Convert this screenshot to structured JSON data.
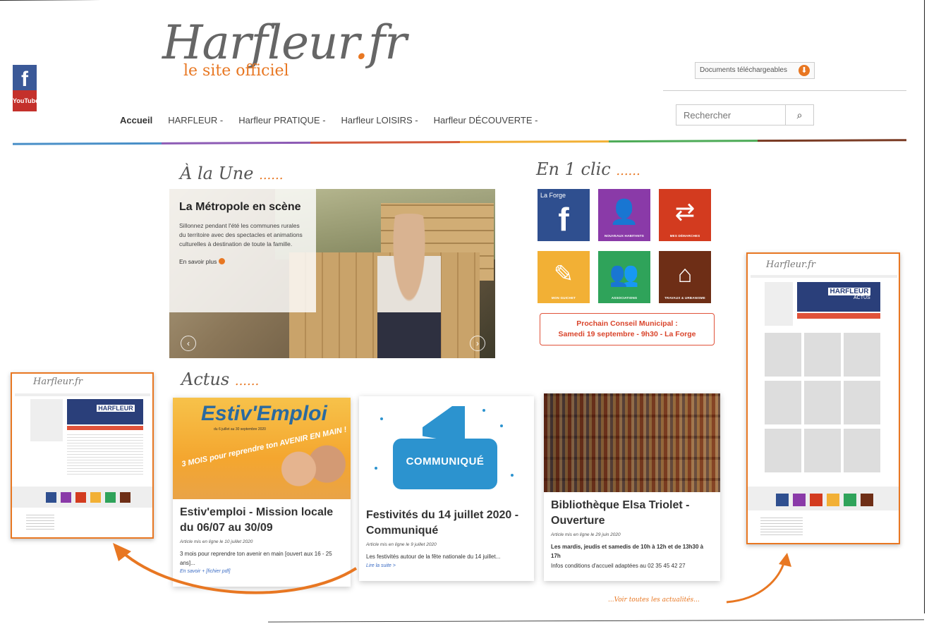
{
  "site": {
    "logo_main": "Harfleur",
    "logo_dot": ".",
    "logo_tld": "fr",
    "logo_sub": "le site officiel"
  },
  "social": {
    "facebook": "f",
    "youtube": "YouTube"
  },
  "header": {
    "docs_label": "Documents téléchargeables",
    "search_placeholder": "Rechercher"
  },
  "nav": {
    "items": [
      {
        "label": "Accueil"
      },
      {
        "label": "HARFLEUR -"
      },
      {
        "label": "Harfleur PRATIQUE -"
      },
      {
        "label": "Harfleur LOISIRS -"
      },
      {
        "label": "Harfleur DÉCOUVERTE -"
      }
    ]
  },
  "colors": {
    "accent": "#e87722",
    "bar": [
      "#4a90c8",
      "#8d5bb5",
      "#d35a3c",
      "#f2b035",
      "#4dab57",
      "#7a3b24"
    ]
  },
  "une": {
    "title": "À la Une",
    "dots": "......",
    "slide_title": "La Métropole en scène",
    "slide_text": "Sillonnez pendant l'été les communes rurales du territoire avec des spectacles et animations culturelles à destination de toute la famille.",
    "slide_more": "En savoir plus"
  },
  "clic": {
    "title": "En 1 clic",
    "dots": "......",
    "tiles": [
      {
        "top": "La Forge",
        "glyph": "f",
        "caption": "",
        "color": "#2f4f8f"
      },
      {
        "top": "",
        "glyph": "👤",
        "caption": "NOUVEAUX HABITANTS",
        "color": "#8a3aa8"
      },
      {
        "top": "",
        "glyph": "⇄",
        "caption": "MES DÉMARCHES",
        "color": "#d33b1f"
      },
      {
        "top": "",
        "glyph": "✎",
        "caption": "MON GUICHET",
        "color": "#f2b035"
      },
      {
        "top": "",
        "glyph": "👥",
        "caption": "ASSOCIATIONS",
        "color": "#2fa35a"
      },
      {
        "top": "",
        "glyph": "⌂",
        "caption": "TRAVAUX & URBANISME",
        "color": "#6e2e16"
      }
    ],
    "conseil_line1": "Prochain Conseil Municipal :",
    "conseil_line2": "Samedi 19 septembre - 9h30 - La Forge"
  },
  "actus": {
    "title": "Actus",
    "dots": "......",
    "cards": [
      {
        "img_title": "Estiv'Emploi",
        "img_sub": "du 6 juillet au 30 septembre 2020",
        "img_slogan": "3 MOIS pour reprendre ton AVENIR EN MAIN !",
        "title": "Estiv'emploi - Mission locale du 06/07 au 30/09",
        "date": "Article mis en ligne le 10 juillet 2020",
        "text": "3 mois pour reprendre ton avenir en main [ouvert aux 16 - 25 ans]...",
        "link": "En savoir + [fichier pdf]"
      },
      {
        "img_title": "COMMUNIQUÉ",
        "title": "Festivités du 14 juillet 2020 - Communiqué",
        "date": "Article mis en ligne le 9 juillet 2020",
        "text": "Les festivités autour de la fête nationale du 14 juillet...",
        "link": "Lire la suite >"
      },
      {
        "title": "Bibliothèque Elsa Triolet - Ouverture",
        "date": "Article mis en ligne le 29 juin 2020",
        "text_bold": "Les mardis, jeudis et samedis de 10h à 12h et de 13h30 à 17h",
        "text": "Infos conditions d'accueil adaptées au 02 35 45 42 27"
      }
    ],
    "voir": "...Voir toutes les actualités..."
  },
  "thumbs": {
    "logo": "Harfleur.fr",
    "banner": "HARFLEUR",
    "banner_sub": "ACTUS"
  }
}
